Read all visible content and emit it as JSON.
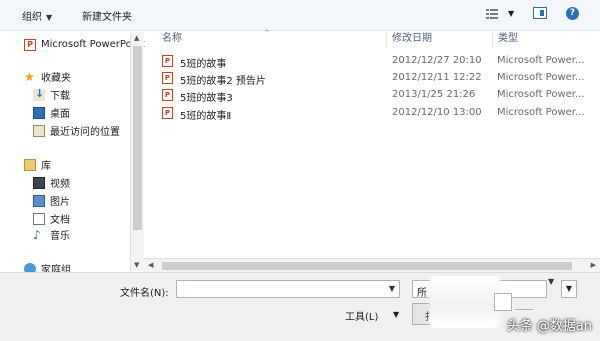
{
  "toolbar": {
    "organize_label": "组织",
    "organize_caret": "▼",
    "new_folder_label": "新建文件夹",
    "view_caret": "▼",
    "help_label": "?"
  },
  "nav": {
    "items": [
      {
        "label": "Microsoft PowerPoint",
        "icon": "powerpoint-icon"
      },
      {
        "label": "收藏夹",
        "icon": "star-icon"
      },
      {
        "label": "下载",
        "icon": "download-folder-icon"
      },
      {
        "label": "桌面",
        "icon": "desktop-icon"
      },
      {
        "label": "最近访问的位置",
        "icon": "recent-places-icon"
      },
      {
        "label": "库",
        "icon": "libraries-icon"
      },
      {
        "label": "视频",
        "icon": "videos-icon"
      },
      {
        "label": "图片",
        "icon": "pictures-icon"
      },
      {
        "label": "文档",
        "icon": "documents-icon"
      },
      {
        "label": "音乐",
        "icon": "music-icon"
      },
      {
        "label": "家庭组",
        "icon": "homegroup-icon"
      }
    ],
    "ppt_glyph": "P",
    "star_glyph": "★",
    "music_glyph": "♪",
    "up_arrow": "▲",
    "down_arrow": "▼"
  },
  "columns": {
    "name": "名称",
    "date": "修改日期",
    "type": "类型",
    "sort_caret": "^"
  },
  "files": [
    {
      "name": "5班的故事",
      "date": "2012/12/27 20:10",
      "type": "Microsoft Power..."
    },
    {
      "name": "5班的故事2 预告片",
      "date": "2012/12/11 12:22",
      "type": "Microsoft Power..."
    },
    {
      "name": "5班的故事3",
      "date": "2013/1/25 21:26",
      "type": "Microsoft Power..."
    },
    {
      "name": "5班的故事Ⅱ",
      "date": "2012/12/10 13:00",
      "type": "Microsoft Power..."
    }
  ],
  "file_icon_glyph": "P",
  "hscroll": {
    "left_arrow": "◀",
    "right_arrow": "▶"
  },
  "bottom": {
    "filename_label": "文件名(N):",
    "filename_value": "",
    "filename_caret": "▼",
    "filetype_value": "所",
    "filetype_caret": "▼",
    "tools_label": "工具(L)",
    "tools_caret": "▼",
    "open_label": "打"
  },
  "watermark": "头条 @数据an",
  "colors": {
    "accent": "#2b6fb6",
    "header_text": "#4c607a",
    "ppt_red": "#c8402a"
  }
}
